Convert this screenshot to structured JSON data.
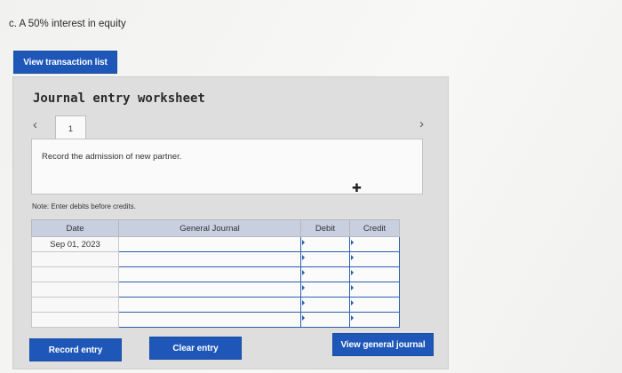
{
  "question": {
    "text": "c. A 50% interest in equity"
  },
  "buttons": {
    "view_transactions": "View transaction list",
    "record_entry": "Record entry",
    "clear_entry": "Clear entry",
    "view_general_journal": "View general journal"
  },
  "worksheet": {
    "title": "Journal entry worksheet",
    "current_tab": "1",
    "instruction": "Record the admission of new partner.",
    "note": "Note: Enter debits before credits."
  },
  "table": {
    "headers": {
      "date": "Date",
      "journal": "General Journal",
      "debit": "Debit",
      "credit": "Credit"
    },
    "rows": [
      {
        "date": "Sep 01, 2023",
        "journal": "",
        "debit": "",
        "credit": ""
      },
      {
        "date": "",
        "journal": "",
        "debit": "",
        "credit": ""
      },
      {
        "date": "",
        "journal": "",
        "debit": "",
        "credit": ""
      },
      {
        "date": "",
        "journal": "",
        "debit": "",
        "credit": ""
      },
      {
        "date": "",
        "journal": "",
        "debit": "",
        "credit": ""
      },
      {
        "date": "",
        "journal": "",
        "debit": "",
        "credit": ""
      }
    ]
  },
  "colors": {
    "accent": "#1e57b8",
    "header": "#c7cfe0",
    "panel": "#dedede"
  },
  "icons": {
    "prev": "chevron-left-icon",
    "next": "chevron-right-icon",
    "cursor": "mouse-pointer-icon"
  }
}
